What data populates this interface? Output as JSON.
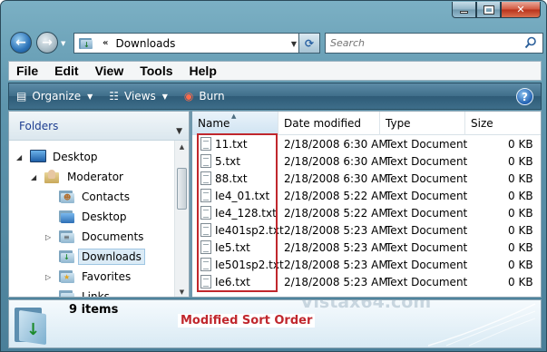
{
  "window": {
    "minimize_icon": "minimize-icon",
    "maximize_icon": "maximize-icon",
    "close_icon": "close-icon"
  },
  "address_bar": {
    "breadcrumb_chevron": "«",
    "location": "Downloads",
    "search_placeholder": "Search"
  },
  "menu": {
    "items": [
      "File",
      "Edit",
      "View",
      "Tools",
      "Help"
    ]
  },
  "command_bar": {
    "organize": "Organize",
    "views": "Views",
    "burn": "Burn",
    "help": "?"
  },
  "navigation_pane": {
    "header": "Folders",
    "items": [
      {
        "label": "Desktop",
        "icon": "desktop-icon"
      },
      {
        "label": "Moderator",
        "icon": "user-folder-icon"
      },
      {
        "label": "Contacts",
        "icon": "contacts-folder-icon"
      },
      {
        "label": "Desktop",
        "icon": "desktop-folder-icon"
      },
      {
        "label": "Documents",
        "icon": "documents-folder-icon"
      },
      {
        "label": "Downloads",
        "icon": "downloads-folder-icon",
        "selected": true
      },
      {
        "label": "Favorites",
        "icon": "favorites-folder-icon"
      },
      {
        "label": "Links",
        "icon": "links-folder-icon"
      }
    ]
  },
  "file_list": {
    "columns": [
      "Name",
      "Date modified",
      "Type",
      "Size"
    ],
    "sorted_by": "Name",
    "rows": [
      {
        "name": "11.txt",
        "date": "2/18/2008 6:30 AM",
        "type": "Text Document",
        "size": "0 KB"
      },
      {
        "name": "5.txt",
        "date": "2/18/2008 6:30 AM",
        "type": "Text Document",
        "size": "0 KB"
      },
      {
        "name": "88.txt",
        "date": "2/18/2008 6:30 AM",
        "type": "Text Document",
        "size": "0 KB"
      },
      {
        "name": "Ie4_01.txt",
        "date": "2/18/2008 5:22 AM",
        "type": "Text Document",
        "size": "0 KB"
      },
      {
        "name": "Ie4_128.txt",
        "date": "2/18/2008 5:22 AM",
        "type": "Text Document",
        "size": "0 KB"
      },
      {
        "name": "Ie401sp2.txt",
        "date": "2/18/2008 5:23 AM",
        "type": "Text Document",
        "size": "0 KB"
      },
      {
        "name": "Ie5.txt",
        "date": "2/18/2008 5:23 AM",
        "type": "Text Document",
        "size": "0 KB"
      },
      {
        "name": "Ie501sp2.txt",
        "date": "2/18/2008 5:23 AM",
        "type": "Text Document",
        "size": "0 KB"
      },
      {
        "name": "Ie6.txt",
        "date": "2/18/2008 5:23 AM",
        "type": "Text Document",
        "size": "0 KB"
      }
    ]
  },
  "details_pane": {
    "items_count": "9 items",
    "annotation": "Modified Sort Order",
    "watermark": "Vistax64.com"
  },
  "colors": {
    "highlight_border": "#c0272d",
    "nav_header_text": "#1e3e91",
    "selection_bg": "#dbebf6"
  }
}
